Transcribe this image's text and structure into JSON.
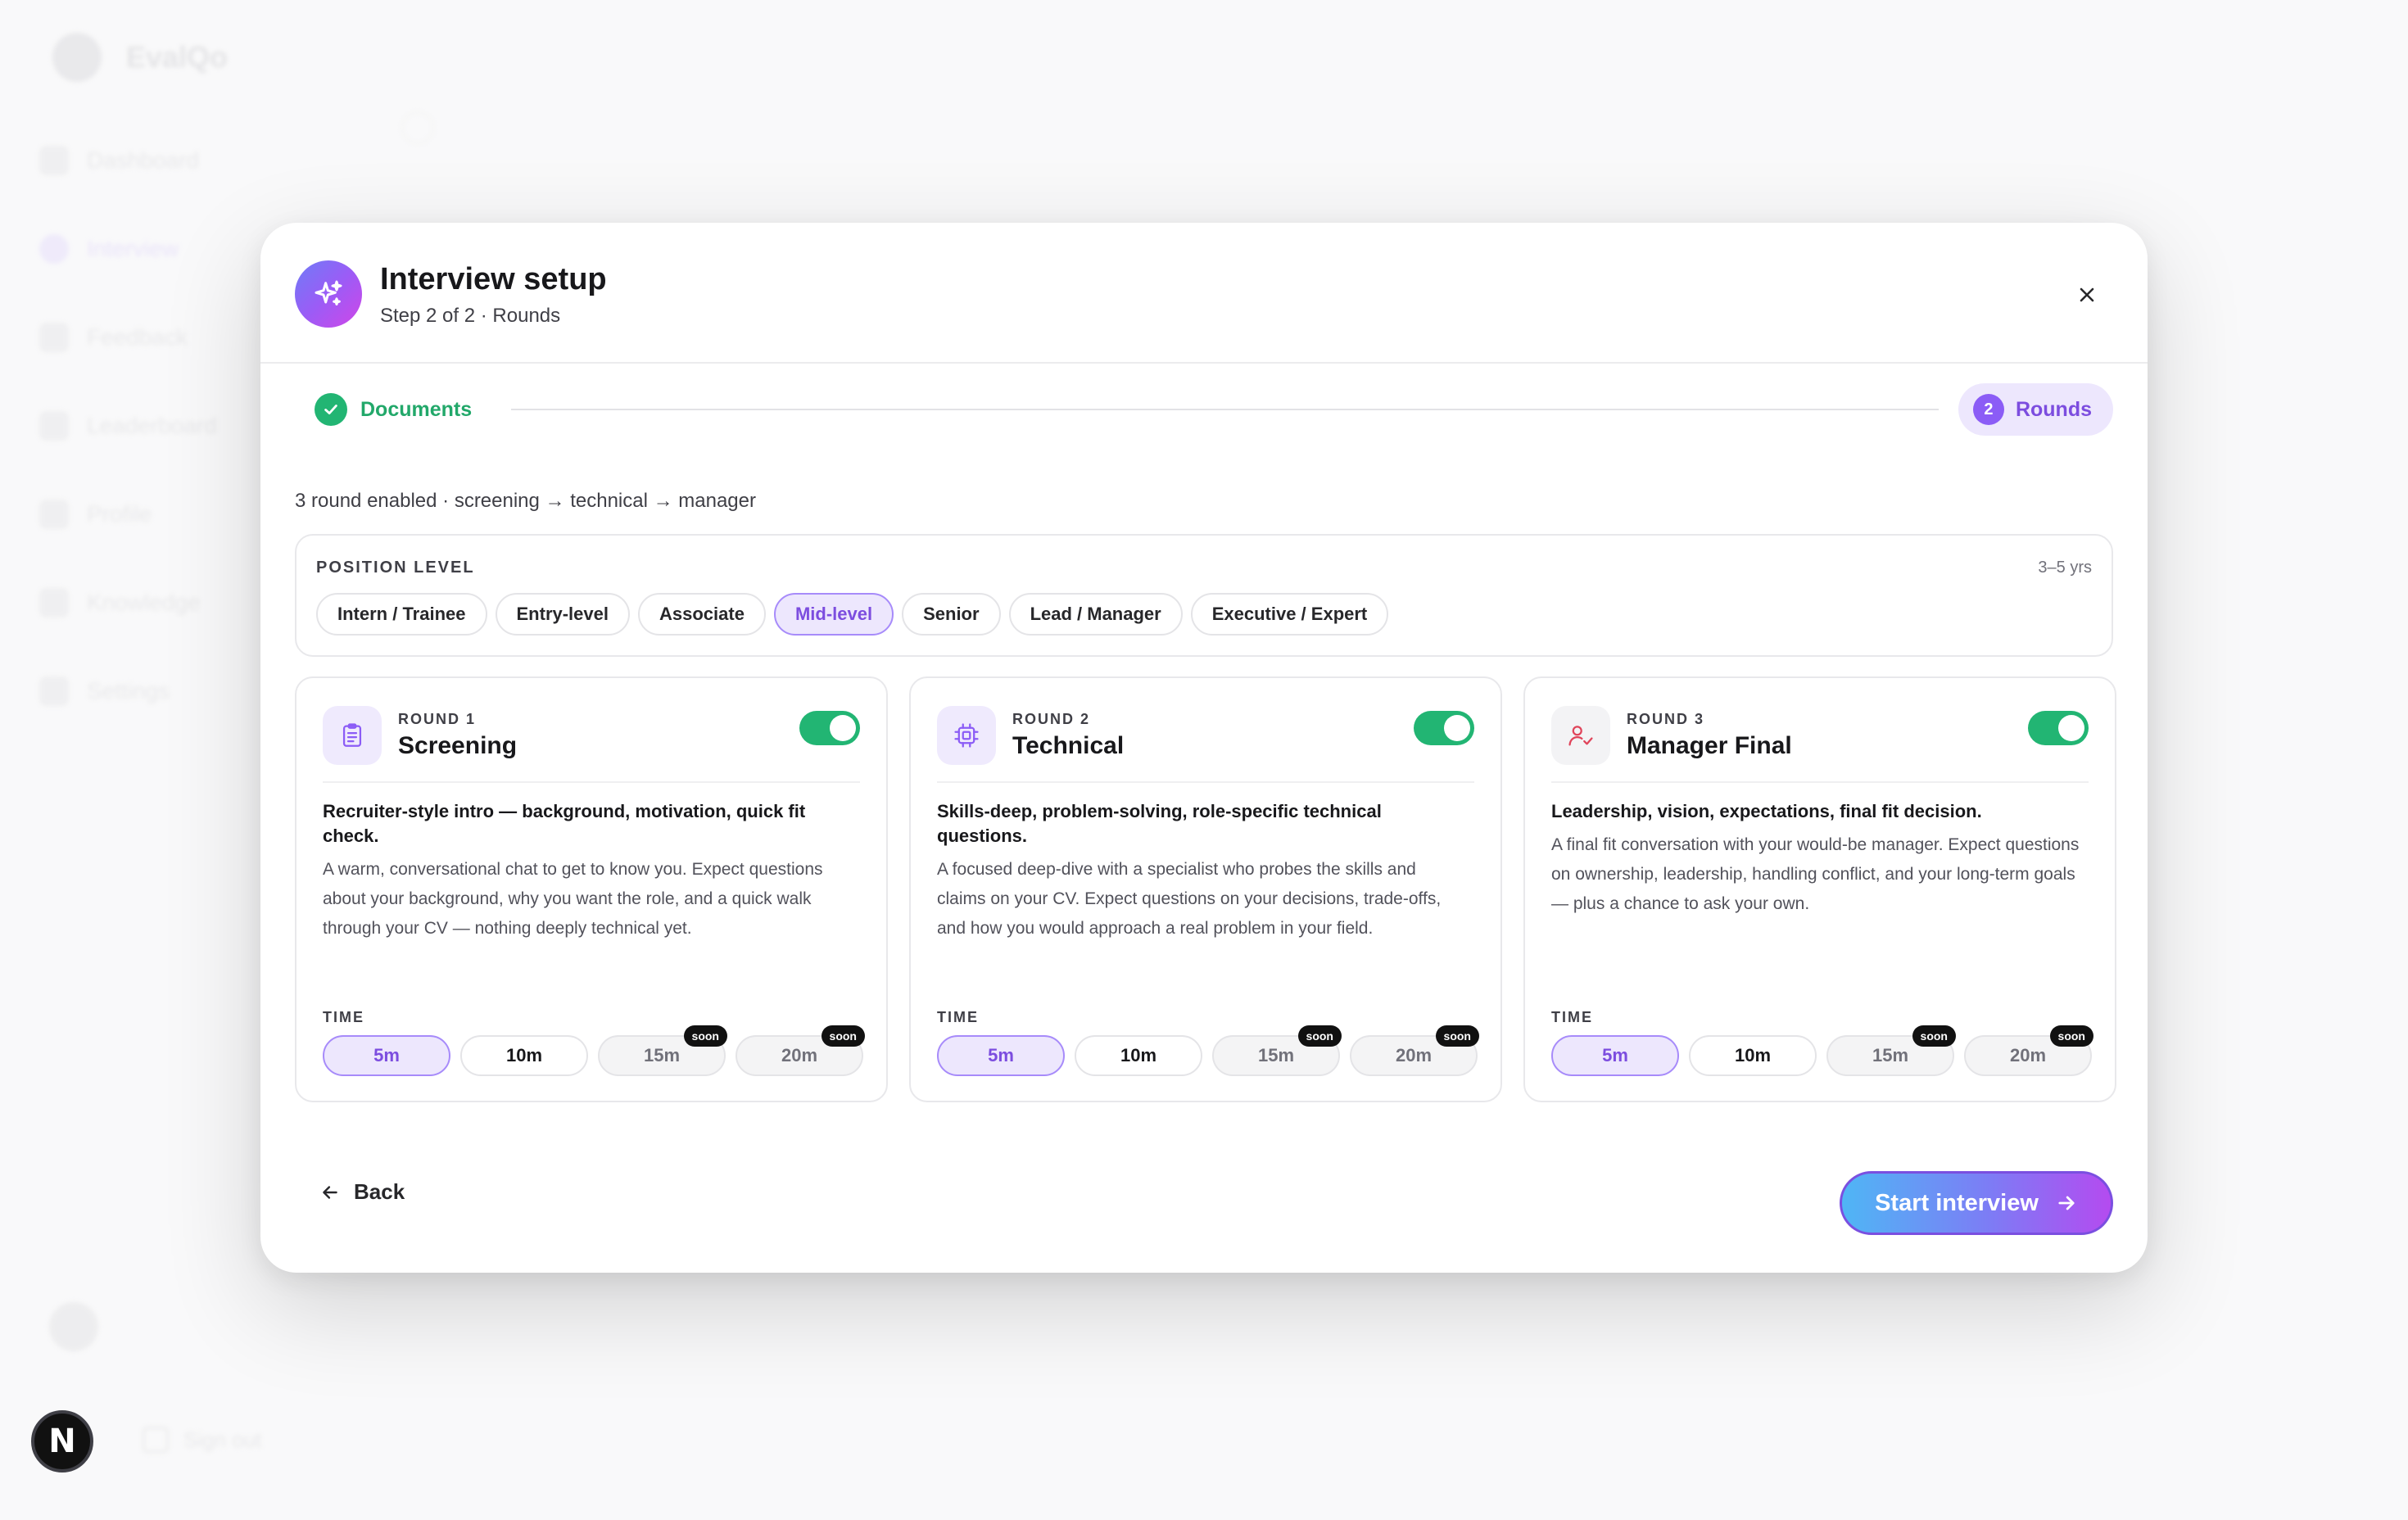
{
  "app": {
    "name": "EvalQo",
    "nav": [
      "Dashboard",
      "Interview",
      "Feedback",
      "Leaderboard",
      "Profile",
      "Knowledge",
      "Settings"
    ],
    "sign_out": "Sign out",
    "dev_badge": "N"
  },
  "modal": {
    "title": "Interview setup",
    "subtitle": "Step 2 of 2 · Rounds",
    "stepper": {
      "done_label": "Documents",
      "active_number": "2",
      "active_label": "Rounds"
    },
    "summary": "3 round enabled · screening → technical → manager",
    "position_level": {
      "label": "POSITION LEVEL",
      "years": "3–5 yrs",
      "options": [
        "Intern / Trainee",
        "Entry-level",
        "Associate",
        "Mid-level",
        "Senior",
        "Lead / Manager",
        "Executive / Expert"
      ],
      "selected": "Mid-level"
    },
    "rounds": [
      {
        "tag": "ROUND 1",
        "name": "Screening",
        "enabled": true,
        "headline": "Recruiter-style intro — background, motivation, quick fit check.",
        "description": "A warm, conversational chat to get to know you. Expect questions about your background, why you want the role, and a quick walk through your CV — nothing deeply technical yet."
      },
      {
        "tag": "ROUND 2",
        "name": "Technical",
        "enabled": true,
        "headline": "Skills-deep, problem-solving, role-specific technical questions.",
        "description": "A focused deep-dive with a specialist who probes the skills and claims on your CV. Expect questions on your decisions, trade-offs, and how you would approach a real problem in your field."
      },
      {
        "tag": "ROUND 3",
        "name": "Manager Final",
        "enabled": true,
        "headline": "Leadership, vision, expectations, final fit decision.",
        "description": "A final fit conversation with your would-be manager. Expect questions on ownership, leadership, handling conflict, and your long-term goals — plus a chance to ask your own."
      }
    ],
    "time": {
      "label": "TIME",
      "options": [
        "5m",
        "10m",
        "15m",
        "20m"
      ],
      "selected": "5m",
      "soon_label": "soon"
    },
    "back_label": "Back",
    "start_label": "Start interview"
  }
}
